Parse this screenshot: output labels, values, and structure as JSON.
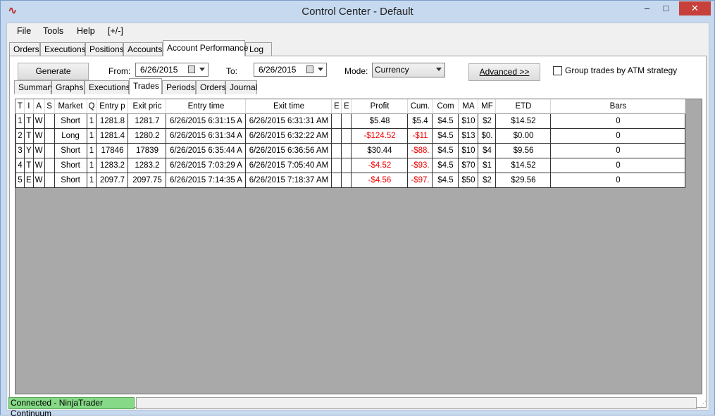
{
  "window": {
    "title": "Control Center - Default",
    "minimize": "–",
    "maximize": "□",
    "close": "✕",
    "app_icon": "∿"
  },
  "menu": [
    "File",
    "Tools",
    "Help",
    "[+/-]"
  ],
  "top_tabs": [
    "Orders",
    "Executions",
    "Positions",
    "Accounts",
    "Account Performance",
    "Log"
  ],
  "top_tab_active": "Account Performance",
  "toolbar": {
    "generate_label": "Generate",
    "from_label": "From:",
    "from_value": "6/26/2015",
    "to_label": "To:",
    "to_value": "6/26/2015",
    "mode_label": "Mode:",
    "mode_value": "Currency",
    "advanced_label": "Advanced >>",
    "group_label": "Group trades by ATM strategy"
  },
  "inner_tabs": [
    "Summary",
    "Graphs",
    "Executions",
    "Trades",
    "Periods",
    "Orders",
    "Journal"
  ],
  "inner_tab_active": "Trades",
  "columns": [
    "T",
    "I",
    "A",
    "S",
    "Market",
    "Q",
    "Entry p",
    "Exit pric",
    "Entry time",
    "Exit time",
    "E",
    "E",
    "Profit",
    "Cum.",
    "Com",
    "MA",
    "MF",
    "ETD",
    "Bars"
  ],
  "rows": [
    [
      "1",
      "T",
      "W",
      "",
      "Short",
      "1",
      "1281.8",
      "1281.7",
      "6/26/2015 6:31:15 A",
      "6/26/2015 6:31:31 AM",
      "",
      "",
      "$5.48",
      "$5.4",
      "$4.5",
      "$10",
      "$2",
      "$14.52",
      "0"
    ],
    [
      "2",
      "T",
      "W",
      "",
      "Long",
      "1",
      "1281.4",
      "1280.2",
      "6/26/2015 6:31:34 A",
      "6/26/2015 6:32:22 AM",
      "",
      "",
      "-$124.52",
      "-$11",
      "$4.5",
      "$13",
      "$0.",
      "$0.00",
      "0"
    ],
    [
      "3",
      "Y",
      "W",
      "",
      "Short",
      "1",
      "17846",
      "17839",
      "6/26/2015 6:35:44 A",
      "6/26/2015 6:36:56 AM",
      "",
      "",
      "$30.44",
      "-$88.",
      "$4.5",
      "$10",
      "$4",
      "$9.56",
      "0"
    ],
    [
      "4",
      "T",
      "W",
      "",
      "Short",
      "1",
      "1283.2",
      "1283.2",
      "6/26/2015 7:03:29 A",
      "6/26/2015 7:05:40 AM",
      "",
      "",
      "-$4.52",
      "-$93.",
      "$4.5",
      "$70",
      "$1",
      "$14.52",
      "0"
    ],
    [
      "5",
      "E",
      "W",
      "",
      "Short",
      "1",
      "2097.7",
      "2097.75",
      "6/26/2015 7:14:35 A",
      "6/26/2015 7:18:37 AM",
      "",
      "",
      "-$4.56",
      "-$97.",
      "$4.5",
      "$50",
      "$2",
      "$29.56",
      "0"
    ]
  ],
  "negative_color": "#e00000",
  "status": {
    "connection": "Connected - NinjaTrader Continuum",
    "connection_color": "#86d986"
  }
}
